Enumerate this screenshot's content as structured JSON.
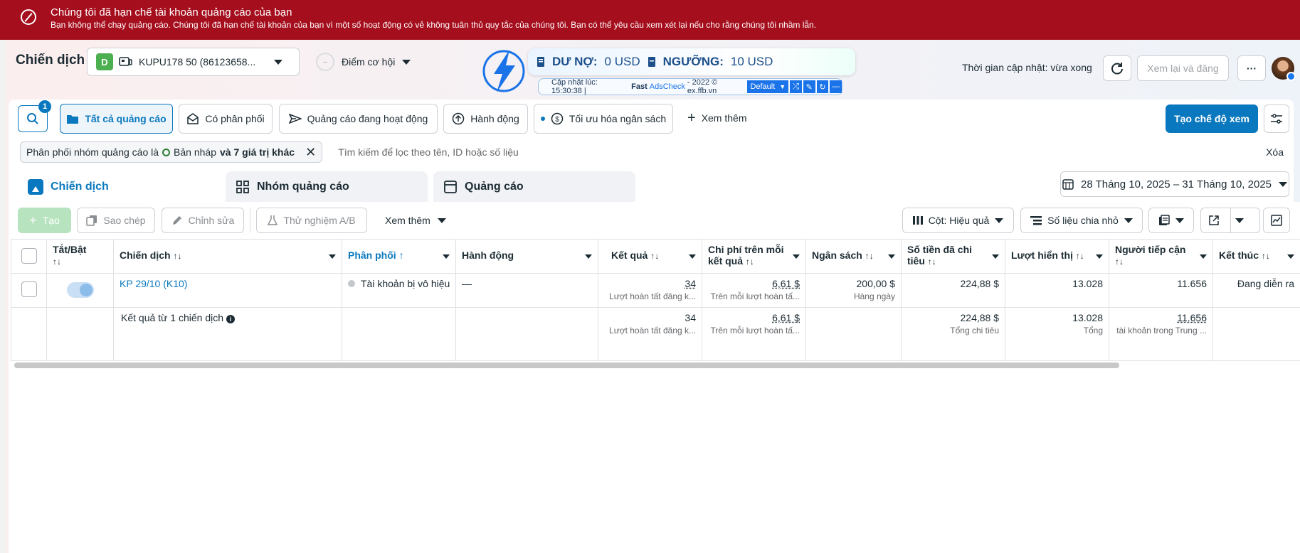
{
  "banner": {
    "title": "Chúng tôi đã hạn chế tài khoản quảng cáo của bạn",
    "message": "Bạn không thể chạy quảng cáo. Chúng tôi đã hạn chế tài khoản của bạn vì một số hoạt động có vẻ không tuân thủ quy tắc của chúng tôi. Bạn có thể yêu cầu xem xét lại nếu cho rằng chúng tôi nhầm lẫn."
  },
  "header": {
    "title": "Chiến dịch",
    "account_initial": "D",
    "account_name": "KUPU178 50 (86123658...",
    "opportunity_label": "Điểm cơ hội",
    "opportunity_score": "--",
    "updated_text": "Thời gian cập nhật: vừa xong",
    "review_publish": "Xem lại và đăng",
    "more": "···"
  },
  "extension": {
    "debt_label": "DƯ NỢ:",
    "debt_value": "0 USD",
    "threshold_label": "NGƯỠNG:",
    "threshold_value": "10 USD",
    "updated_prefix": "Cập nhật lúc: 15:30:38 |",
    "fast": "Fast",
    "adscheck": "AdsCheck",
    "copyright": "- 2022 © ex.ffb.vn",
    "preset": "Default"
  },
  "filters": {
    "search_badge": "1",
    "all_ads": "Tất cả quảng cáo",
    "has_delivery": "Có phân phối",
    "active_ads": "Quảng cáo đang hoạt động",
    "actions": "Hành động",
    "optimize_budget": "Tối ưu hóa ngân sách",
    "see_more": "Xem thêm",
    "create_view": "Tạo chế độ xem"
  },
  "filterbar": {
    "chip_prefix": "Phân phối nhóm quảng cáo là",
    "chip_value": "Bản nháp",
    "chip_suffix": "và 7 giá trị khác",
    "placeholder": "Tìm kiếm để lọc theo tên, ID hoặc số liệu",
    "clear": "Xóa"
  },
  "tabs": {
    "campaigns": "Chiến dịch",
    "adsets": "Nhóm quảng cáo",
    "ads": "Quảng cáo"
  },
  "date_range": "28 Tháng 10, 2025 – 31 Tháng 10, 2025",
  "toolbar": {
    "create": "Tạo",
    "duplicate": "Sao chép",
    "edit": "Chỉnh sửa",
    "ab_test": "Thử nghiệm A/B",
    "more": "Xem thêm",
    "columns": "Cột: Hiệu quả",
    "breakdown": "Số liệu chia nhỏ"
  },
  "table": {
    "headers": {
      "toggle": "Tắt/Bật",
      "campaign": "Chiến dịch",
      "delivery": "Phân phối",
      "actions": "Hành động",
      "results": "Kết quả",
      "cost_per_result": "Chi phí trên mỗi kết quả",
      "budget": "Ngân sách",
      "amount_spent": "Số tiền đã chi tiêu",
      "impressions": "Lượt hiển thị",
      "reach": "Người tiếp cận",
      "ends": "Kết thúc"
    },
    "row": {
      "campaign": "KP 29/10 (K10)",
      "delivery": "Tài khoản bị vô hiệu",
      "actions": "—",
      "results": "34",
      "results_sub": "Lượt hoàn tất đăng k...",
      "cost": "6,61 $",
      "cost_sub": "Trên mỗi lượt hoàn tấ...",
      "budget": "200,00 $",
      "budget_sub": "Hàng ngày",
      "spent": "224,88 $",
      "impressions": "13.028",
      "reach": "11.656",
      "ends": "Đang diễn ra"
    },
    "summary": {
      "label": "Kết quả từ 1 chiến dịch",
      "results": "34",
      "results_sub": "Lượt hoàn tất đăng k...",
      "cost": "6,61 $",
      "cost_sub": "Trên mỗi lượt hoàn tấ...",
      "spent": "224,88 $",
      "spent_sub": "Tổng chi tiêu",
      "impressions": "13.028",
      "impressions_sub": "Tổng",
      "reach": "11.656",
      "reach_sub": "tài khoản trong Trung ..."
    }
  }
}
